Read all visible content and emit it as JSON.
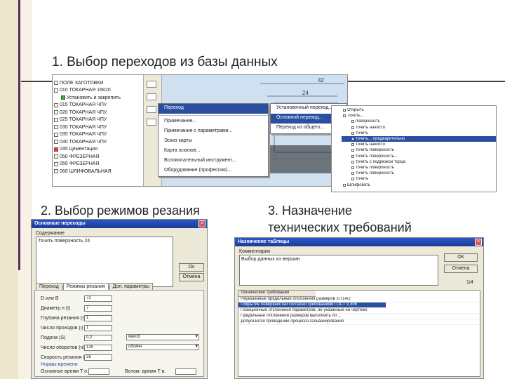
{
  "slide": {
    "title": "1. Выбор переходов из базы данных",
    "label_2": "2. Выбор режимов резания",
    "label_3_line1": "3. Назначение",
    "label_3_line2": "технических требований"
  },
  "screen1": {
    "tree": [
      "ПОЛЕ ЗАГОТОВКИ",
      "010 ТОКАРНАЯ 16К20",
      "Установить и закрепить",
      "015 ТОКАРНАЯ ЧПУ",
      "020 ТОКАРНАЯ ЧПУ",
      "025 ТОКАРНАЯ ЧПУ",
      "030 ТОКАРНАЯ ЧПУ",
      "035 ТОКАРНАЯ ЧПУ",
      "040 ТОКАРНАЯ ЧПУ",
      "045 Цементация",
      "050 ФРЕЗЕРНАЯ",
      "055 ФРЕЗЕРНАЯ",
      "060 ШЛИФОВАЛЬНАЯ"
    ],
    "context_menu": [
      "Переход",
      "Примечание...",
      "Примечание с параметрами...",
      "Эскиз карты",
      "Карта эскизов...",
      "Вспомогательный инструмент...",
      "Оборудование (профессия)..."
    ],
    "submenu": [
      "Установочный переход...",
      "Основной переход...",
      "Переход из общего..."
    ],
    "dims": [
      "42",
      "24"
    ],
    "req_tree": [
      "Открыть",
      "Точить...",
      "поверхность",
      "точить начисто",
      "точить",
      "точить... предварительно",
      "точить начисто",
      "точить поверхность",
      "точить поверхность...",
      "точить с подрезкой торца",
      "точить поверхность",
      "точить поверхность",
      "точить",
      "Шлифовать"
    ]
  },
  "screen2": {
    "title": "Основные переходы",
    "content_label": "Содержание",
    "content_text": "Точить поверхность 24",
    "ok": "Ок",
    "cancel": "Отмена",
    "tabs": [
      "Переход",
      "Режимы резания",
      "Доп. параметры"
    ],
    "fields": [
      {
        "label": "D или B",
        "value": "72"
      },
      {
        "label": "Диаметр н (l)",
        "value": "7"
      },
      {
        "label": "Глубина резания (t)",
        "value": "1"
      },
      {
        "label": "Число проходов (i)",
        "value": "1"
      },
      {
        "label": "Подача (S)",
        "value": "0,2"
      },
      {
        "label": "Число оборотов (n)",
        "value": "125"
      },
      {
        "label": "Скорость резания (V)",
        "value": "28"
      }
    ],
    "feed_unit": "мм/об",
    "speed_unit": "об/мин",
    "norms_label": "Нормы времени",
    "time_main_label": "Основное время T о.",
    "time_aux_label": "Вспом. время T в."
  },
  "screen3": {
    "title": "Назначение таблицы",
    "comment_label": "Комментарии",
    "comment_text": "Выбор данных из вершин",
    "ok": "ОК",
    "cancel": "Отмена",
    "counter": "1/4",
    "list_header": "Технические требования",
    "requirements": [
      "Неуказанные предельные отклонения размеров ±IT14/2",
      "Покрытие поверхностей согласно требованиям ГОСТ 9.306",
      "Позиционные отклонения параметров, не указанные на чертеже",
      "Предельные отклонения размеров выполнять по ...",
      "Допускается проведение процесса гальванирования"
    ]
  },
  "colors": {
    "accent": "#5a2d5c",
    "selection": "#2a4fa0",
    "title_bar": "#2b58c8"
  }
}
